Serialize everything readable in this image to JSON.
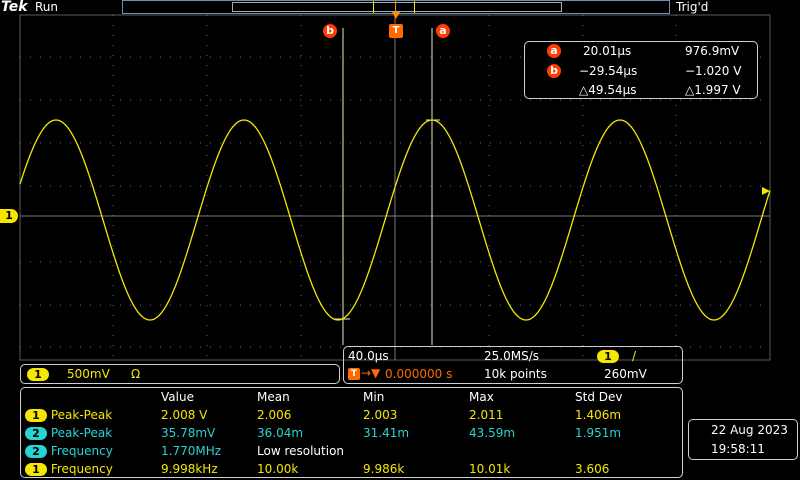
{
  "header": {
    "brand": "Tek",
    "run_state": "Run",
    "trigger_state": "Trig'd"
  },
  "cursors": {
    "a_label": "a",
    "b_label": "b",
    "trigger_label": "T",
    "a_time": "20.01µs",
    "a_volt": "976.9mV",
    "b_time": "−29.54µs",
    "b_volt": "−1.020 V",
    "delta_time": "△49.54µs",
    "delta_volt": "△1.997 V"
  },
  "channel1": {
    "label": "1",
    "scale": "500mV",
    "impedance": "Ω",
    "color": "#f5e700"
  },
  "channel2": {
    "label": "2",
    "color": "#29d3d3"
  },
  "timebase": {
    "horizontal_scale": "40.0µs",
    "sample_rate": "25.0MS/s",
    "trigger_position": "0.000000 s",
    "record_length": "10k points",
    "trigger_channel": "1",
    "trigger_slope": "/",
    "trigger_level": "260mV"
  },
  "measurements": {
    "headers": [
      "Value",
      "Mean",
      "Min",
      "Max",
      "Std Dev"
    ],
    "rows": [
      {
        "ch": "1",
        "name": "Peak-Peak",
        "value": "2.008 V",
        "mean": "2.006",
        "min": "2.003",
        "max": "2.011",
        "std": "1.406m"
      },
      {
        "ch": "2",
        "name": "Peak-Peak",
        "value": "35.78mV",
        "mean": "36.04m",
        "min": "31.41m",
        "max": "43.59m",
        "std": "1.951m"
      },
      {
        "ch": "2",
        "name": "Frequency",
        "value": "1.770MHz",
        "mean": "Low resolution",
        "min": "",
        "max": "",
        "std": ""
      },
      {
        "ch": "1",
        "name": "Frequency",
        "value": "9.998kHz",
        "mean": "10.00k",
        "min": "9.986k",
        "max": "10.01k",
        "std": "3.606"
      }
    ]
  },
  "datetime": {
    "date": "22 Aug 2023",
    "time": "19:58:11"
  }
}
